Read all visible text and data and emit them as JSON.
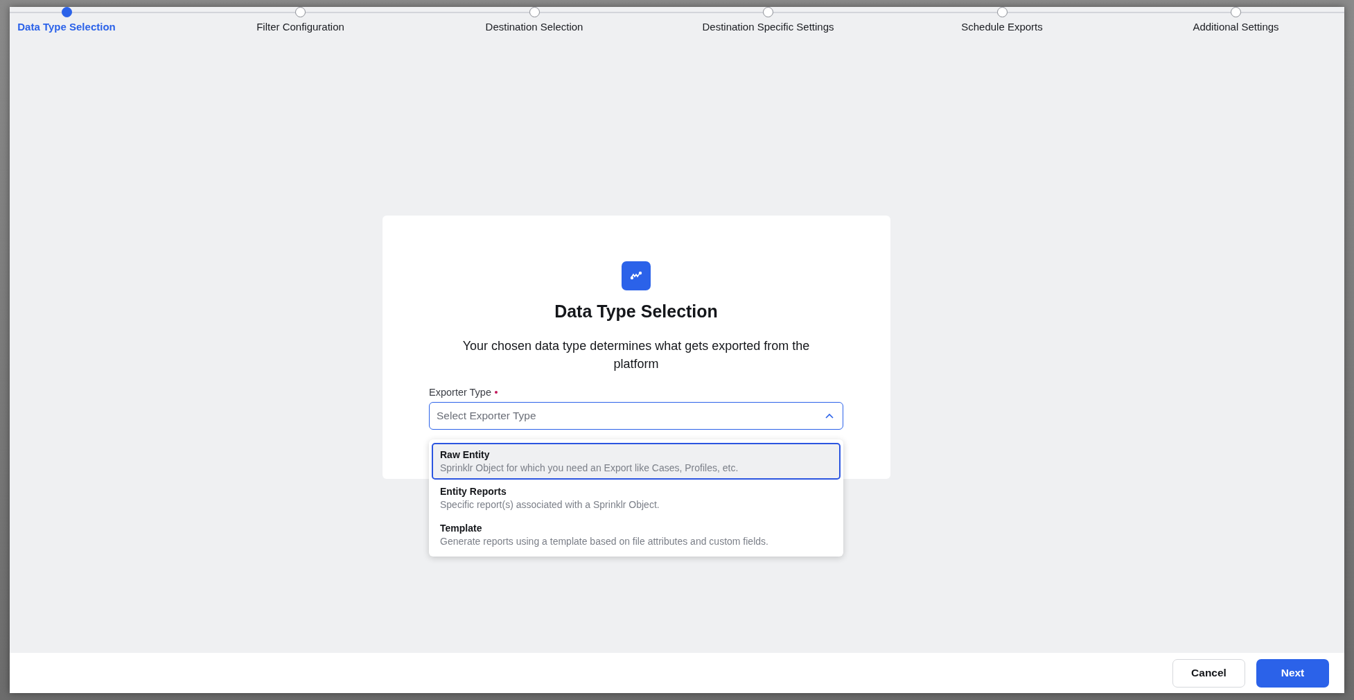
{
  "stepper": {
    "steps": [
      {
        "label": "Data Type Selection",
        "selected": true
      },
      {
        "label": "Filter Configuration",
        "selected": false
      },
      {
        "label": "Destination Selection",
        "selected": false
      },
      {
        "label": "Destination Specific Settings",
        "selected": false
      },
      {
        "label": "Schedule Exports",
        "selected": false
      },
      {
        "label": "Additional Settings",
        "selected": false
      }
    ]
  },
  "card": {
    "title": "Data Type Selection",
    "description": "Your chosen data type determines what gets exported from the platform",
    "field": {
      "label": "Exporter Type",
      "required": true,
      "placeholder": "Select Exporter Type",
      "expanded": true
    },
    "options": [
      {
        "title": "Raw Entity",
        "description": "Sprinklr Object for which you need an Export like Cases, Profiles, etc.",
        "selected": true
      },
      {
        "title": "Entity Reports",
        "description": "Specific report(s) associated with a Sprinklr Object.",
        "selected": false
      },
      {
        "title": "Template",
        "description": "Generate reports using a template based on file attributes and custom fields.",
        "selected": false
      }
    ]
  },
  "footer": {
    "buttons": [
      {
        "label": "Cancel",
        "kind": "secondary"
      },
      {
        "label": "Next",
        "kind": "primary"
      }
    ]
  }
}
